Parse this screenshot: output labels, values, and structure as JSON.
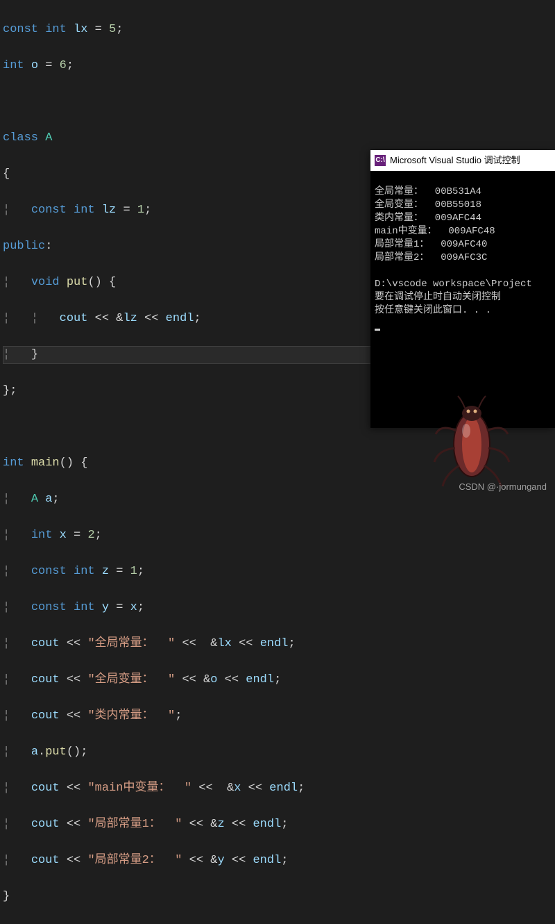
{
  "code": {
    "line1": {
      "kw1": "const",
      "kw2": "int",
      "var": "lx",
      "op": "=",
      "num": "5",
      "semi": ";"
    },
    "line2": {
      "kw": "int",
      "var": "o",
      "op": "=",
      "num": "6",
      "semi": ";"
    },
    "line4": {
      "kw": "class",
      "name": "A"
    },
    "line5": {
      "brace": "{"
    },
    "line6": {
      "kw1": "const",
      "kw2": "int",
      "var": "lz",
      "op": "=",
      "num": "1",
      "semi": ";"
    },
    "line7": {
      "kw": "public",
      "colon": ":"
    },
    "line8": {
      "kw": "void",
      "fn": "put",
      "paren": "()",
      "brace": " {"
    },
    "line9": {
      "obj": "cout",
      "op1": " << ",
      "amp": "&",
      "var": "lz",
      "op2": " << ",
      "endl": "endl",
      "semi": ";"
    },
    "line10": {
      "brace": "}"
    },
    "line11": {
      "brace": "}",
      "semi": ";"
    },
    "line13": {
      "kw": "int",
      "fn": "main",
      "paren": "()",
      "brace": " {"
    },
    "line14": {
      "type": "A",
      "var": "a",
      "semi": ";"
    },
    "line15": {
      "kw": "int",
      "var": "x",
      "op": " = ",
      "num": "2",
      "semi": ";"
    },
    "line16": {
      "kw1": "const",
      "kw2": "int",
      "var": "z",
      "op": " = ",
      "num": "1",
      "semi": ";"
    },
    "line17": {
      "kw1": "const",
      "kw2": "int",
      "var": "y",
      "op": " = ",
      "rhs": "x",
      "semi": ";"
    },
    "line18": {
      "obj": "cout",
      "op1": " << ",
      "str": "\"全局常量：  \"",
      "op2": " <<  ",
      "amp": "&",
      "var": "lx",
      "op3": " << ",
      "endl": "endl",
      "semi": ";"
    },
    "line19": {
      "obj": "cout",
      "op1": " << ",
      "str": "\"全局变量：  \"",
      "op2": " << ",
      "amp": "&",
      "var": "o",
      "op3": " << ",
      "endl": "endl",
      "semi": ";"
    },
    "line20": {
      "obj": "cout",
      "op1": " << ",
      "str": "\"类内常量：  \"",
      "semi": ";"
    },
    "line21": {
      "obj": "a",
      "dot": ".",
      "fn": "put",
      "paren": "()",
      "semi": ";"
    },
    "line22": {
      "obj": "cout",
      "op1": " << ",
      "str": "\"main中变量：  \"",
      "op2": " <<  ",
      "amp": "&",
      "var": "x",
      "op3": " << ",
      "endl": "endl",
      "semi": ";"
    },
    "line23": {
      "obj": "cout",
      "op1": " << ",
      "str": "\"局部常量1：  \"",
      "op2": " << ",
      "amp": "&",
      "var": "z",
      "op3": " << ",
      "endl": "endl",
      "semi": ";"
    },
    "line24": {
      "obj": "cout",
      "op1": " << ",
      "str": "\"局部常量2：  \"",
      "op2": " << ",
      "amp": "&",
      "var": "y",
      "op3": " << ",
      "endl": "endl",
      "semi": ";"
    },
    "line25": {
      "brace": "}"
    }
  },
  "console": {
    "iconText": "C:\\",
    "title": "Microsoft Visual Studio 调试控制",
    "lines": [
      "全局常量：  00B531A4",
      "全局变量：  00B55018",
      "类内常量：  009AFC44",
      "main中变量：  009AFC48",
      "局部常量1：  009AFC40",
      "局部常量2：  009AFC3C",
      "",
      "D:\\vscode workspace\\Project",
      "要在调试停止时自动关闭控制",
      "按任意键关闭此窗口. . ."
    ]
  },
  "watermark": "CSDN @·jormungand"
}
